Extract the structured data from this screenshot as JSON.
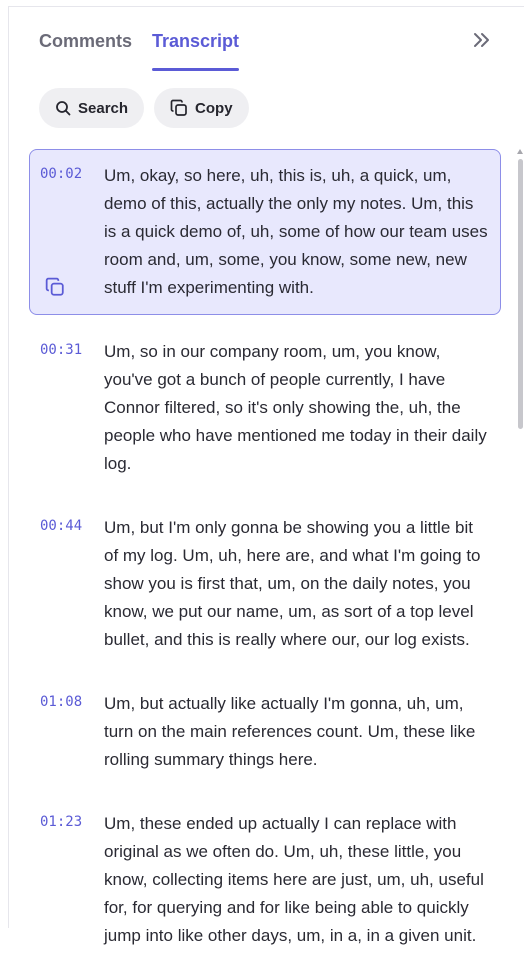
{
  "tabs": [
    {
      "label": "Comments",
      "active": false
    },
    {
      "label": "Transcript",
      "active": true
    }
  ],
  "actions": {
    "search_label": "Search",
    "copy_label": "Copy"
  },
  "icons": {
    "collapse": "double-chevron-right-icon",
    "search": "search-icon",
    "copy": "copy-icon"
  },
  "colors": {
    "accent": "#5b5bd6",
    "highlight_bg": "#e8e8fd",
    "highlight_border": "#8d8ee8"
  },
  "transcript": [
    {
      "time": "00:02",
      "text": "Um, okay, so here, uh, this is, uh, a quick, um, demo of this, actually the only my notes. Um, this is a quick demo of, uh, some of how our team uses room and, um, some, you know, some new, new stuff I'm experimenting with.",
      "highlighted": true
    },
    {
      "time": "00:31",
      "text": "Um, so in our company room, um, you know, you've got a bunch of people currently, I have Connor filtered, so it's only showing the, uh, the people who have mentioned me today in their daily log.",
      "highlighted": false
    },
    {
      "time": "00:44",
      "text": "Um, but I'm only gonna be showing you a little bit of my log. Um, uh, here are, and what I'm going to show you is first that, um, on the daily notes, you know, we put our name, um, as sort of a top level bullet, and this is really where our, our log exists.",
      "highlighted": false
    },
    {
      "time": "01:08",
      "text": "Um, but actually like actually I'm gonna, uh, um, turn on the main references count. Um, these like rolling summary things here.",
      "highlighted": false
    },
    {
      "time": "01:23",
      "text": "Um, these ended up actually I can replace with original as we often do. Um, uh, these little, you know, collecting items here are just, um, uh, useful for, for querying and for like being able to quickly jump into like other days, um, in a, in a given unit.",
      "highlighted": false
    }
  ]
}
